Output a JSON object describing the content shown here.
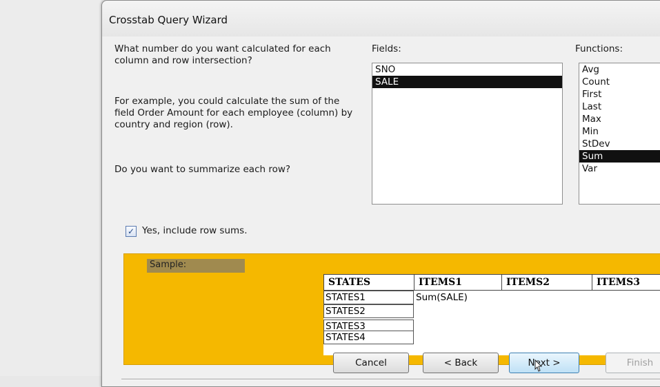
{
  "dialog": {
    "title": "Crosstab Query Wizard"
  },
  "instructions": {
    "question": "What number do you want calculated for each column and row intersection?",
    "example": "For example, you could calculate the sum of the field Order Amount for each employee (column) by country and region (row).",
    "summarize_question": "Do you want to summarize each row?",
    "checkbox_label": "Yes, include row sums.",
    "checkbox_checked": true
  },
  "fields": {
    "label": "Fields:",
    "items": [
      "SNO",
      "SALE"
    ],
    "selected": "SALE"
  },
  "functions": {
    "label": "Functions:",
    "items": [
      "Avg",
      "Count",
      "First",
      "Last",
      "Max",
      "Min",
      "StDev",
      "Sum",
      "Var"
    ],
    "selected": "Sum"
  },
  "sample": {
    "label": "Sample:",
    "columns": [
      "STATES",
      "ITEMS1",
      "ITEMS2",
      "ITEMS3"
    ],
    "rows": [
      "STATES1",
      "STATES2",
      "STATES3",
      "STATES4"
    ],
    "cell": "Sum(SALE)"
  },
  "buttons": {
    "cancel": "Cancel",
    "back": "< Back",
    "next": "Next >",
    "finish": "Finish"
  },
  "colors": {
    "sample_bg": "#f5b800",
    "selection": "#111111"
  }
}
